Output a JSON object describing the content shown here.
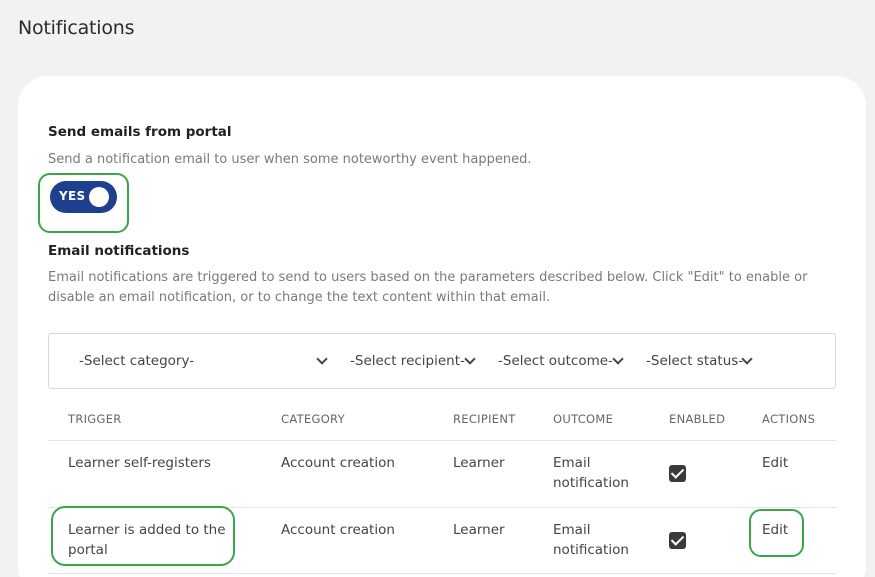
{
  "page": {
    "title": "Notifications"
  },
  "send_emails": {
    "title": "Send emails from portal",
    "description": "Send a notification email to user when some noteworthy event happened.",
    "toggle_label": "YES"
  },
  "email_notifications": {
    "title": "Email notifications",
    "description_line1": "Email notifications are triggered to send to users based on the parameters described below. Click \"Edit\" to enable or",
    "description_line2": "disable an email notification, or to change the text content within that email."
  },
  "filters": {
    "category": "-Select category-",
    "recipient": "-Select recipient-",
    "outcome": "-Select outcome-",
    "status": "-Select status-"
  },
  "table": {
    "headers": {
      "trigger": "TRIGGER",
      "category": "CATEGORY",
      "recipient": "RECIPIENT",
      "outcome": "OUTCOME",
      "enabled": "ENABLED",
      "actions": "ACTIONS"
    },
    "rows": [
      {
        "trigger_line1": "Learner self-registers",
        "trigger_line2": "",
        "category": "Account creation",
        "recipient": "Learner",
        "outcome_line1": "Email",
        "outcome_line2": "notification",
        "enabled": true,
        "action": "Edit"
      },
      {
        "trigger_line1": "Learner is added to the",
        "trigger_line2": "portal",
        "category": "Account creation",
        "recipient": "Learner",
        "outcome_line1": "Email",
        "outcome_line2": "notification",
        "enabled": true,
        "action": "Edit"
      }
    ]
  },
  "colors": {
    "toggle": "#1f3f8f",
    "highlight": "#3aa64a",
    "background": "#f2f2f2"
  }
}
